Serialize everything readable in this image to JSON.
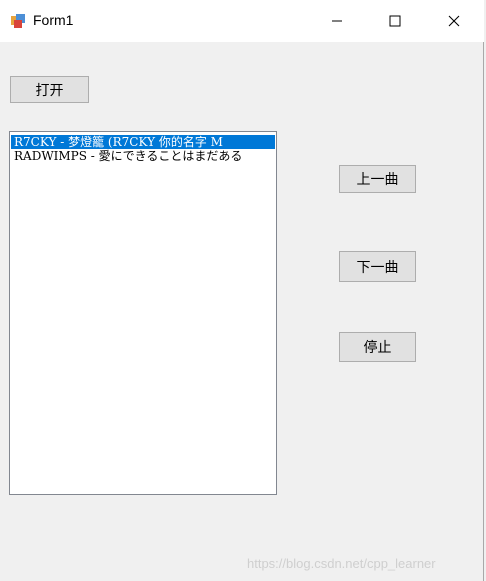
{
  "window": {
    "title": "Form1",
    "icon": "winforms-app-icon",
    "controls": {
      "minimize": "minimize-icon",
      "maximize": "maximize-icon",
      "close": "close-icon"
    }
  },
  "buttons": {
    "open": "打开",
    "prev": "上一曲",
    "next": "下一曲",
    "stop": "停止"
  },
  "playlist": {
    "items": [
      "R7CKY - 梦燈籠 (R7CKY  你的名字  M",
      "RADWIMPS - 愛にできることはまだある"
    ],
    "selected_index": 0
  },
  "watermark": "https://blog.csdn.net/cpp_learner",
  "colors": {
    "selection": "#0078d7",
    "window_bg": "#f0f0f0"
  }
}
